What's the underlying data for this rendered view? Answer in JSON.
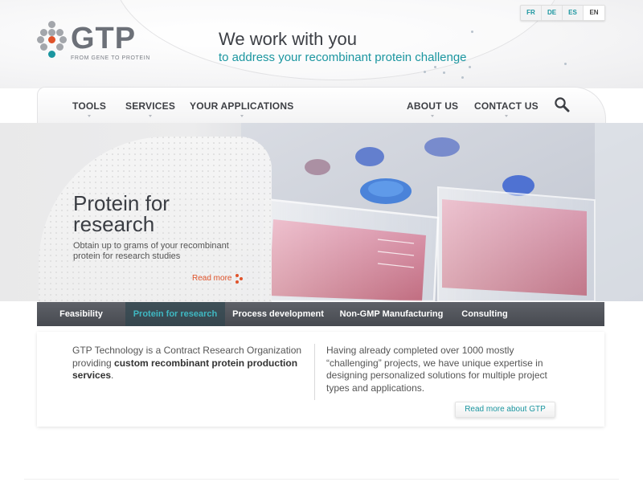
{
  "brand": {
    "logo_text": "GTP",
    "logo_tagline": "FROM GENE TO PROTEIN",
    "colors": {
      "teal": "#1b96a0",
      "orange": "#e0532a",
      "grey": "#6c7078",
      "tab_bg": "#4f5259"
    }
  },
  "header": {
    "tagline_main": "We work with you",
    "tagline_sub": "to address your recombinant protein challenge"
  },
  "languages": [
    {
      "code": "FR",
      "current": false
    },
    {
      "code": "DE",
      "current": false
    },
    {
      "code": "ES",
      "current": false
    },
    {
      "code": "EN",
      "current": true
    }
  ],
  "nav": {
    "left": [
      "TOOLS",
      "SERVICES",
      "YOUR APPLICATIONS"
    ],
    "right": [
      "ABOUT US",
      "CONTACT US"
    ],
    "search_icon": "search-icon"
  },
  "hero": {
    "title": "Protein for research",
    "description": "Obtain up to grams of your recombinant protein for research studies",
    "read_more": "Read more"
  },
  "tabs": [
    {
      "label": "Feasibility",
      "active": false
    },
    {
      "label": "Protein for research",
      "active": true
    },
    {
      "label": "Process development",
      "active": false
    },
    {
      "label": "Non-GMP Manufacturing",
      "active": false
    },
    {
      "label": "Consulting",
      "active": false
    }
  ],
  "info": {
    "left_intro": "GTP Technology is a Contract Research Organization providing",
    "left_bold": "custom recombinant protein production services",
    "left_end": ".",
    "right_text": "Having already completed over 1000 mostly “challenging” projects, we have unique expertise in designing personalized solutions for multiple project types and applications.",
    "button": "Read more about GTP"
  }
}
